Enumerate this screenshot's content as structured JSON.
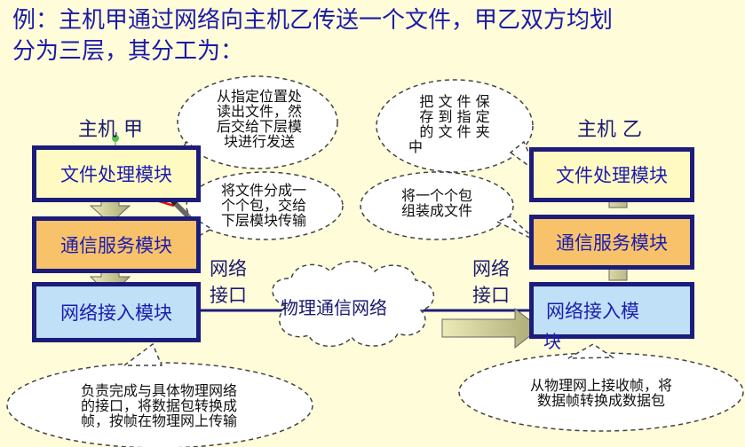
{
  "title_line1": "例：主机甲通过网络向主机乙传送一个文件，甲乙双方均划",
  "title_line2": "分为三层，其分工为：",
  "host_a": "主机 甲",
  "host_b": "主机 乙",
  "host_a_modules": {
    "file": "文件处理模块",
    "comm": "通信服务模块",
    "net": "网络接入模块"
  },
  "host_b_modules": {
    "file": "文件处理模块",
    "comm": "通信服务模块",
    "net": "网络接入模"
  },
  "host_b_net_tail": "块",
  "net_iface_left": [
    "网络",
    "接口"
  ],
  "net_iface_right": [
    "网络",
    "接口"
  ],
  "cloud_label": "物理通信网络",
  "bubbles": {
    "a_file": [
      "从指定位置处",
      "读出文件，然",
      "后交给下层模",
      "块进行发送"
    ],
    "a_comm": [
      "将文件分成一",
      "个个包，交给",
      "下层模块传输"
    ],
    "a_net": [
      "负责完成与具体物理网络",
      "的接口，将数据包转换成",
      "帧，按帧在物理网上传输"
    ],
    "b_file": [
      "把 文 件 保",
      "存 到 指 定",
      "的 文 件 夹",
      "中"
    ],
    "b_comm": [
      "将一个个包",
      "组装成文件"
    ],
    "b_net": [
      "从物理网上接收帧，将",
      "数据帧转换成数据包"
    ]
  },
  "colors": {
    "background": "#fffcd9",
    "title": "#1a1aa8",
    "module_border": "#1c1c7a",
    "file_module": "#fefac2",
    "comm_module": "#f7c26a",
    "net_module": "#bfe0f7",
    "arrow_fill": "#c9c98f",
    "cloud": "#ffffff"
  }
}
